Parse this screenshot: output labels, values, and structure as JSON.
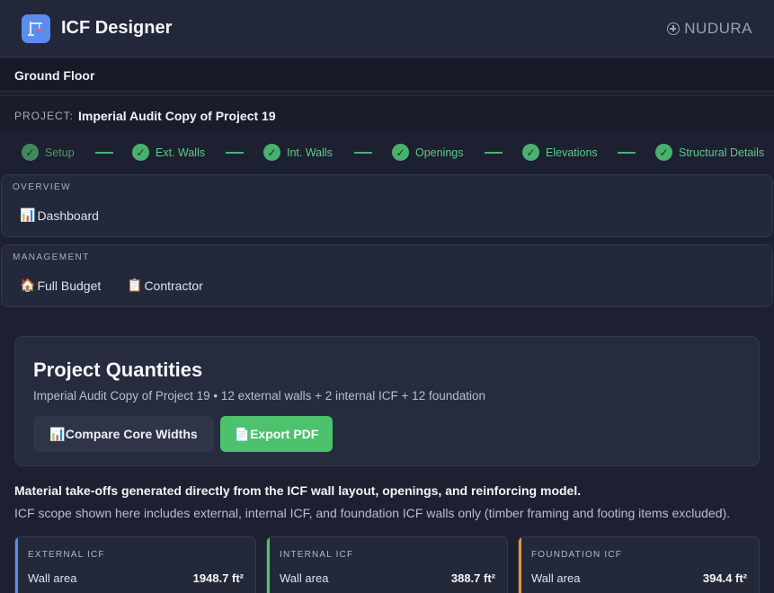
{
  "header": {
    "app_title": "ICF Designer",
    "brand": "NUDURA",
    "logo_icon": "crane-icon",
    "brand_icon": "circle-plus-icon"
  },
  "floor": {
    "label": "Ground Floor"
  },
  "project": {
    "key": "PROJECT:",
    "name": "Imperial Audit Copy of Project 19"
  },
  "steps": [
    {
      "label": "Setup"
    },
    {
      "label": "Ext. Walls"
    },
    {
      "label": "Int. Walls"
    },
    {
      "label": "Openings"
    },
    {
      "label": "Elevations"
    },
    {
      "label": "Structural Details"
    }
  ],
  "overview": {
    "title": "OVERVIEW",
    "items": [
      {
        "icon": "📊",
        "label": "Dashboard"
      }
    ]
  },
  "management": {
    "title": "MANAGEMENT",
    "items": [
      {
        "icon": "🏠",
        "label": "Full Budget"
      },
      {
        "icon": "📋",
        "label": "Contractor"
      }
    ]
  },
  "quantities": {
    "title": "Project Quantities",
    "subtitle": "Imperial Audit Copy of Project 19 • 12 external walls + 2 internal ICF + 12 foundation",
    "compare_icon": "📊",
    "compare_label": "Compare Core Widths",
    "export_icon": "📄",
    "export_label": "Export PDF"
  },
  "info": {
    "bold": "Material take-offs generated directly from the ICF wall layout, openings, and reinforcing model.",
    "normal": "ICF scope shown here includes external, internal ICF, and foundation ICF walls only (timber framing and footing items excluded)."
  },
  "metrics": [
    {
      "title": "EXTERNAL ICF",
      "key": "Wall area",
      "value": "1948.7 ft²"
    },
    {
      "title": "INTERNAL ICF",
      "key": "Wall area",
      "value": "388.7 ft²"
    },
    {
      "title": "FOUNDATION ICF",
      "key": "Wall area",
      "value": "394.4 ft²"
    }
  ],
  "colors": {
    "accent_blue": "#5b8def",
    "accent_green": "#4cc26c",
    "accent_orange": "#e09a3e",
    "background": "#1c2030"
  }
}
